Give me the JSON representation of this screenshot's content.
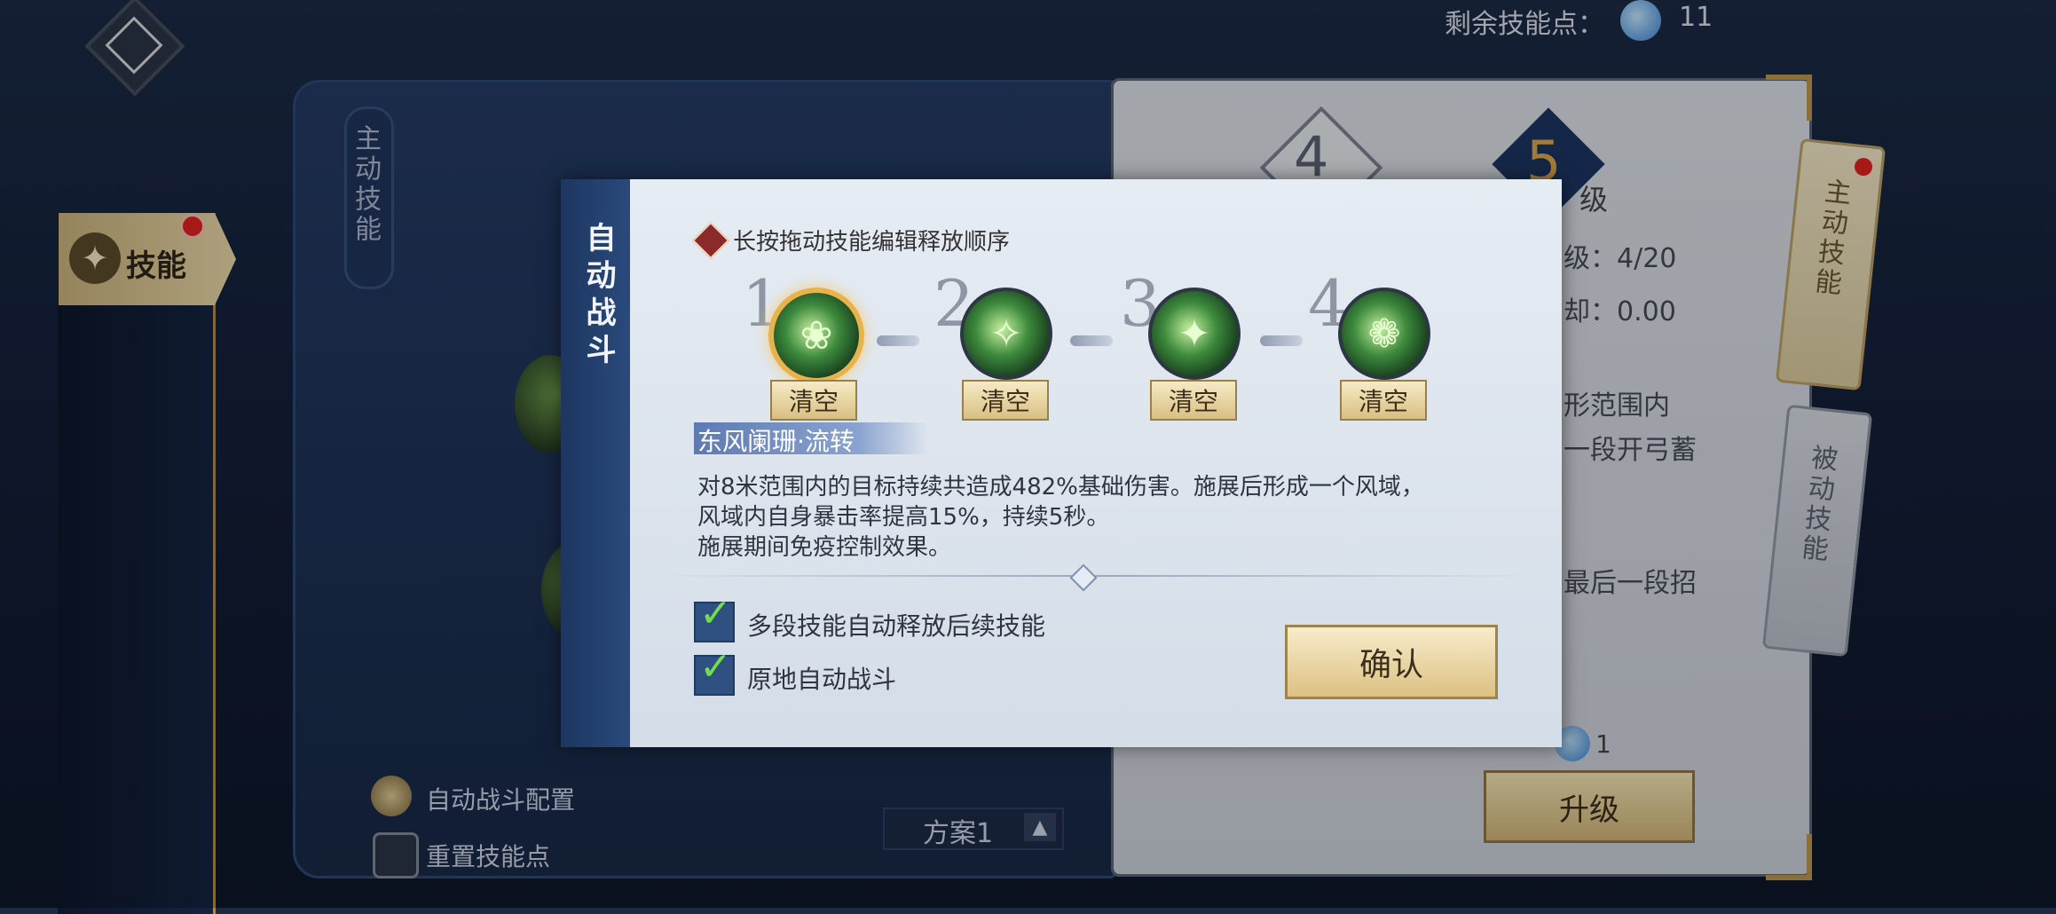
{
  "header": {
    "remaining_label": "剩余技能点：",
    "remaining_value": "11",
    "remaining_icon": "spirit-point-icon"
  },
  "nav": {
    "menu_icon": "diamond-menu-icon",
    "skill_tab_label": "技能"
  },
  "book": {
    "vertical_tab": "主动技能",
    "side_tabs": [
      "主动技能",
      "被动技能"
    ],
    "level_from": "4",
    "level_to": "5",
    "level_unit": "级",
    "lines": [
      "级：4/20",
      "却：0.00",
      "形范围内",
      "一段开弓蓄",
      "最后一段招"
    ],
    "upgrade_cost": "1",
    "upgrade_label": "升级",
    "auto_config_label": "自动战斗配置",
    "reset_label": "重置技能点",
    "plan_label": "方案1"
  },
  "dialog": {
    "side_title": "自动战斗",
    "hint": "长按拖动技能编辑释放顺序",
    "slots": [
      {
        "num": "1",
        "clear": "清空",
        "selected": true
      },
      {
        "num": "2",
        "clear": "清空",
        "selected": false
      },
      {
        "num": "3",
        "clear": "清空",
        "selected": false
      },
      {
        "num": "4",
        "clear": "清空",
        "selected": false
      }
    ],
    "skill_name": "东风阑珊·流转",
    "description": [
      "对8米范围内的目标持续共造成482%基础伤害。施展后形成一个风域，",
      "风域内自身暴击率提高15%，持续5秒。",
      "施展期间免疫控制效果。"
    ],
    "options": [
      {
        "label": "多段技能自动释放后续技能",
        "checked": true
      },
      {
        "label": "原地自动战斗",
        "checked": true
      }
    ],
    "confirm_label": "确认"
  },
  "colors": {
    "accent_gold": "#d9bf82",
    "panel_blue": "#1c3660",
    "check_green": "#73dd4a"
  }
}
